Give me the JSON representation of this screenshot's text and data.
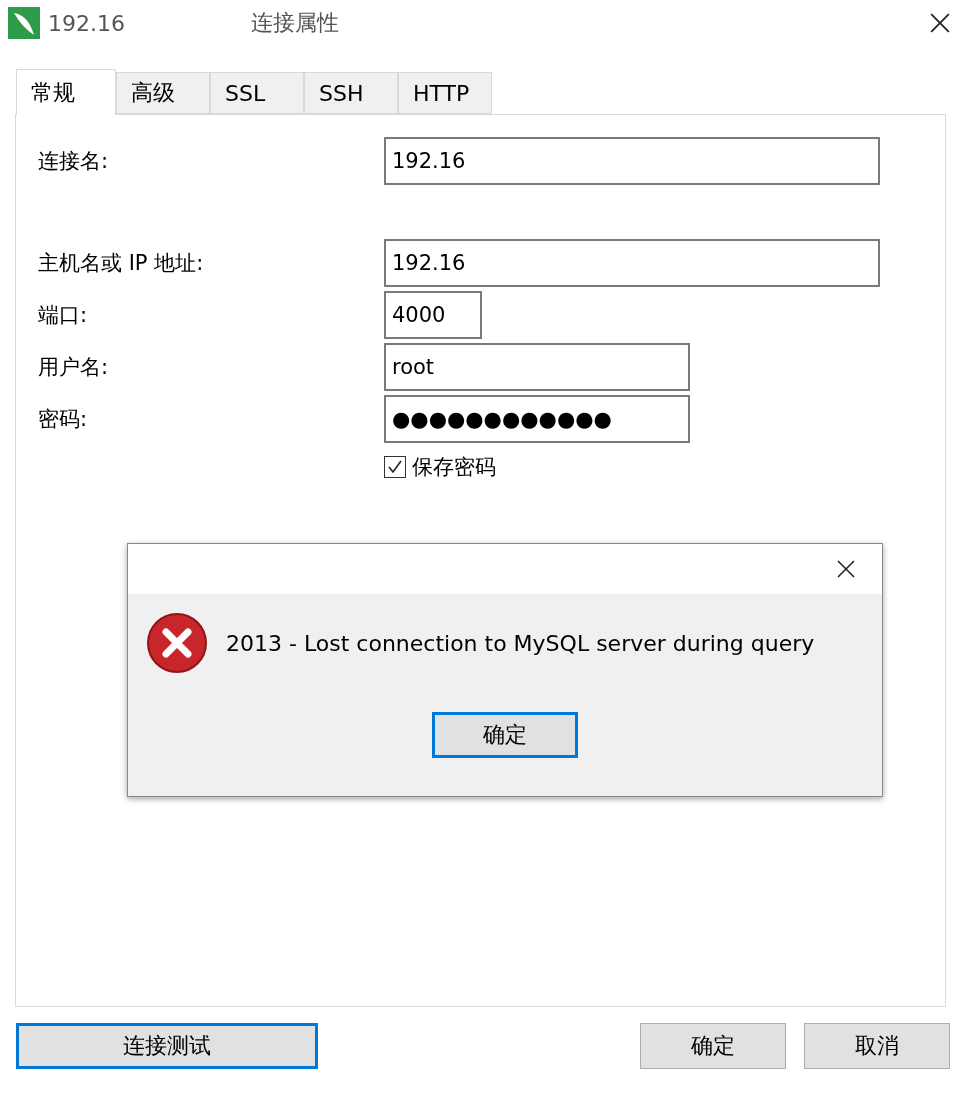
{
  "window": {
    "title_prefix": "192.16",
    "title": "连接属性"
  },
  "tabs": [
    {
      "label": "常规",
      "selected": true
    },
    {
      "label": "高级",
      "selected": false
    },
    {
      "label": "SSL",
      "selected": false
    },
    {
      "label": "SSH",
      "selected": false
    },
    {
      "label": "HTTP",
      "selected": false
    }
  ],
  "form": {
    "fields": [
      {
        "label": "连接名:",
        "value": "192.16"
      },
      {
        "label": "主机名或 IP 地址:",
        "value": "192.16"
      },
      {
        "label": "端口:",
        "value": "4000"
      },
      {
        "label": "用户名:",
        "value": "root"
      },
      {
        "label": "密码:",
        "value": "●●●●●●●●●●●●"
      }
    ],
    "save_password": {
      "label": "保存密码",
      "checked": true
    }
  },
  "dialog": {
    "message": "2013 - Lost connection to MySQL server during query",
    "button": {
      "label": "确定",
      "focused": true
    }
  },
  "buttons": [
    {
      "label": "连接测试",
      "focused": true
    },
    {
      "label": "确定",
      "focused": false
    },
    {
      "label": "取消",
      "focused": false
    }
  ]
}
